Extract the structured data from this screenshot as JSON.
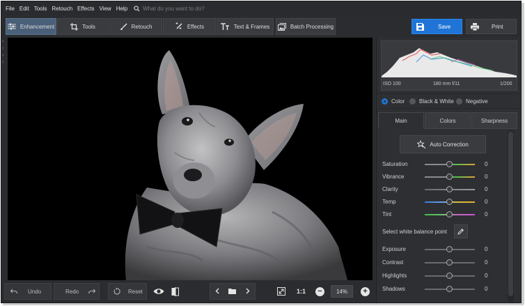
{
  "menu": [
    "File",
    "Edit",
    "Tools",
    "Retouch",
    "Effects",
    "View",
    "Help"
  ],
  "search": {
    "placeholder": "What do you want to do?"
  },
  "tabs": [
    {
      "label": "Enhancement",
      "active": true,
      "icon": "sliders-icon"
    },
    {
      "label": "Tools",
      "icon": "crop-icon"
    },
    {
      "label": "Retouch",
      "icon": "brush-icon"
    },
    {
      "label": "Effects",
      "icon": "magic-wand-icon"
    },
    {
      "label": "Text & Frames",
      "icon": "text-icon"
    },
    {
      "label": "Batch Processing",
      "icon": "images-icon"
    }
  ],
  "actions": {
    "save": "Save",
    "print": "Print"
  },
  "histogram": {
    "iso": "ISO 100",
    "lens": "180 mm f/11",
    "shutter": "1/200"
  },
  "color_modes": [
    {
      "label": "Color",
      "selected": true
    },
    {
      "label": "Black & White",
      "selected": false
    },
    {
      "label": "Negative",
      "selected": false
    }
  ],
  "panel_tabs": [
    {
      "label": "Main",
      "active": true
    },
    {
      "label": "Colors",
      "active": false
    },
    {
      "label": "Sharpness",
      "active": false
    }
  ],
  "auto_correction": "Auto Correction",
  "sliders_top": [
    {
      "label": "Saturation",
      "value": "0",
      "gradient": "linear-gradient(90deg,#8a8a8a,#8a8a8a 45%,#4fbf4f 60%,#e0a43a)"
    },
    {
      "label": "Vibrance",
      "value": "0",
      "gradient": "linear-gradient(90deg,#8a8a8a,#8a8a8a 45%,#4fbf4f 60%,#e0a43a)"
    },
    {
      "label": "Clarity",
      "value": "0",
      "gradient": "linear-gradient(90deg,#6a6b70,#9a9a9a)"
    },
    {
      "label": "Temp",
      "value": "0",
      "gradient": "linear-gradient(90deg,#2f7fe0,#7aa9e0 45%,#d8c040 60%,#e0b030)"
    },
    {
      "label": "Tint",
      "value": "0",
      "gradient": "linear-gradient(90deg,#3fbf3f,#7fbf7f 45%,#c070c0 60%,#d050d0)"
    }
  ],
  "white_balance": "Select white balance point",
  "sliders_bottom": [
    {
      "label": "Exposure",
      "value": "0"
    },
    {
      "label": "Contrast",
      "value": "0"
    },
    {
      "label": "Highlights",
      "value": "0"
    },
    {
      "label": "Shadows",
      "value": "0"
    }
  ],
  "bottom": {
    "undo": "Undo",
    "redo": "Redo",
    "reset": "Reset",
    "ratio": "1:1",
    "zoom": "14%"
  }
}
